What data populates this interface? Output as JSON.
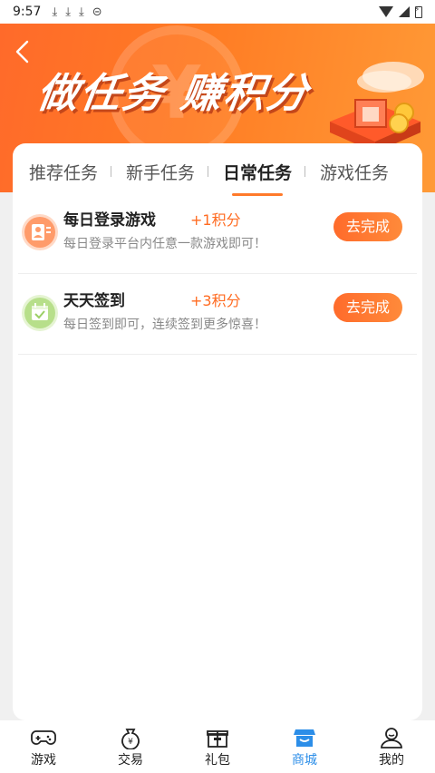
{
  "status_bar": {
    "time": "9:57"
  },
  "banner": {
    "title": "做任务 赚积分",
    "coin_symbol": "¥"
  },
  "tabs": [
    {
      "label": "推荐任务",
      "active": false
    },
    {
      "label": "新手任务",
      "active": false
    },
    {
      "label": "日常任务",
      "active": true
    },
    {
      "label": "游戏任务",
      "active": false
    }
  ],
  "tasks": [
    {
      "name": "每日登录游戏",
      "points": "+1积分",
      "desc": "每日登录平台内任意一款游戏即可！",
      "button": "去完成",
      "icon": "user-icon"
    },
    {
      "name": "天天签到",
      "points": "+3积分",
      "desc": "每日签到即可，连续签到更多惊喜！",
      "button": "去完成",
      "icon": "calendar-check-icon"
    }
  ],
  "bottom_nav": [
    {
      "label": "游戏",
      "icon": "gamepad-icon",
      "active": false
    },
    {
      "label": "交易",
      "icon": "money-bag-icon",
      "active": false
    },
    {
      "label": "礼包",
      "icon": "gift-icon",
      "active": false
    },
    {
      "label": "商城",
      "icon": "shop-icon",
      "active": true
    },
    {
      "label": "我的",
      "icon": "person-icon",
      "active": false
    }
  ],
  "colors": {
    "accent": "#ff6b21",
    "nav_active": "#2c8ee8"
  }
}
